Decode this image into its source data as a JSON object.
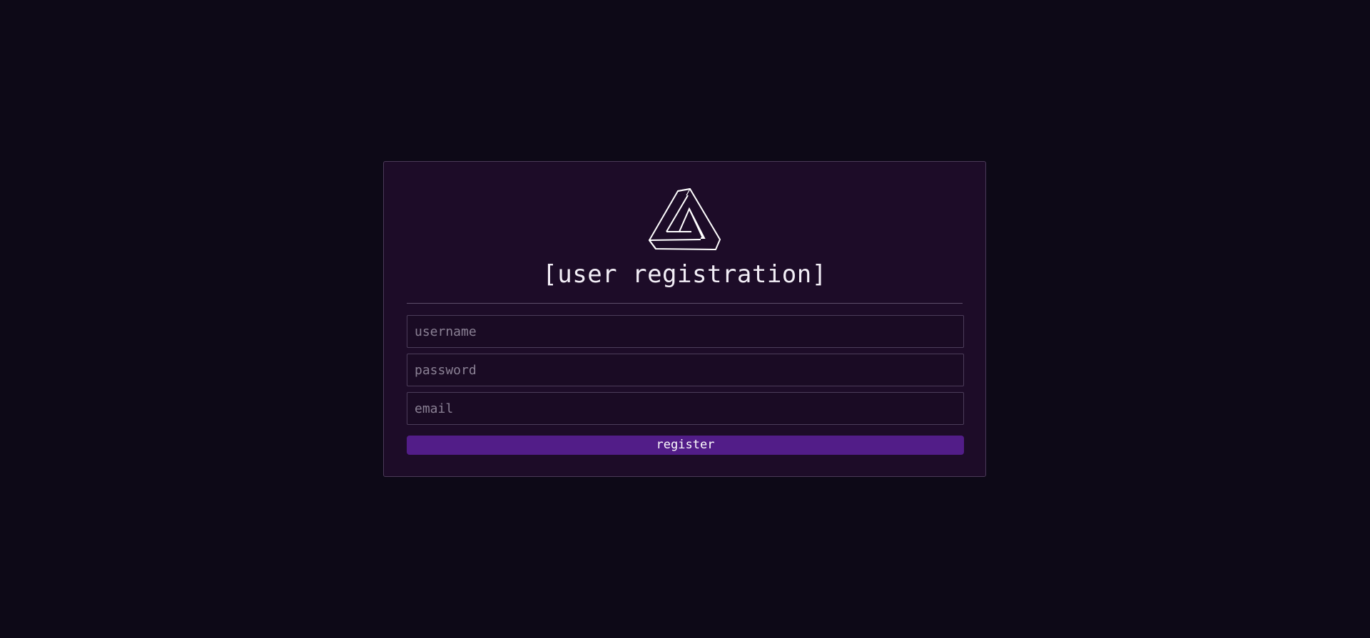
{
  "form": {
    "title": "[user registration]",
    "logo_icon": "impossible-triangle-icon",
    "username_placeholder": "username",
    "password_placeholder": "password",
    "email_placeholder": "email",
    "username_value": "",
    "password_value": "",
    "email_value": "",
    "submit_label": "register"
  },
  "colors": {
    "background": "#0d0917",
    "card": "#1d0c28",
    "accent": "#521d88",
    "text": "#f2eef6"
  }
}
